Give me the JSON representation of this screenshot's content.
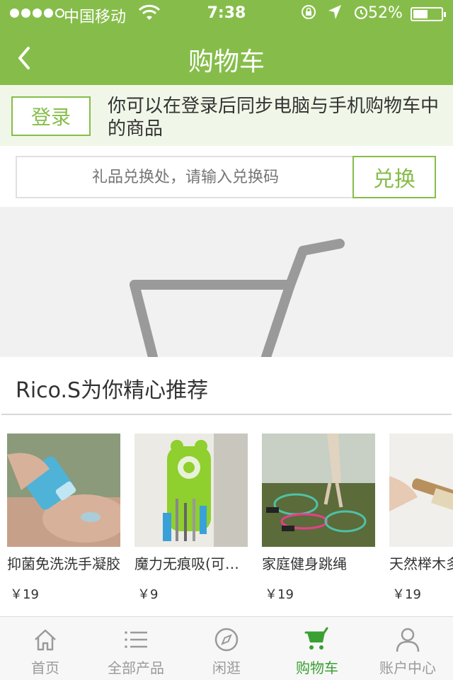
{
  "status_bar": {
    "carrier": "中国移动",
    "time": "7:38",
    "battery_percent": "52%",
    "battery_level": 0.52
  },
  "nav": {
    "title": "购物车",
    "back_icon": "chevron-left-icon"
  },
  "login_banner": {
    "login_label": "登录",
    "message": "你可以在登录后同步电脑与手机购物车中的商品"
  },
  "redeem": {
    "placeholder": "礼品兑换处，请输入兑换码",
    "button_label": "兑换"
  },
  "empty_cart": {
    "icon": "shopping-cart-icon"
  },
  "recommend": {
    "title": "Rico.S为你精心推荐",
    "products": [
      {
        "name": "抑菌免洗洗手凝胶",
        "price": "￥19"
      },
      {
        "name": "魔力无痕吸(可挂挂钩)",
        "price": "￥9"
      },
      {
        "name": "家庭健身跳绳",
        "price": "￥19"
      },
      {
        "name": "天然榉木多用刷",
        "price": "￥19"
      }
    ]
  },
  "tabs": [
    {
      "label": "首页",
      "icon": "home-icon",
      "active": false
    },
    {
      "label": "全部产品",
      "icon": "list-icon",
      "active": false
    },
    {
      "label": "闲逛",
      "icon": "compass-icon",
      "active": false
    },
    {
      "label": "购物车",
      "icon": "cart-icon",
      "active": true
    },
    {
      "label": "账户中心",
      "icon": "user-icon",
      "active": false
    }
  ],
  "colors": {
    "brand_green": "#86bd4a",
    "active_tab": "#3aa033"
  }
}
